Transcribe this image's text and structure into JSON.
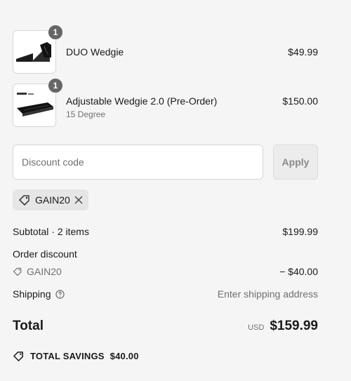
{
  "items": [
    {
      "name": "DUO Wedgie",
      "variant": "",
      "price": "$49.99",
      "quantity": "1",
      "image_icon": "duo-wedgie-thumbnail"
    },
    {
      "name": "Adjustable Wedgie 2.0 (Pre-Order)",
      "variant": "15 Degree",
      "price": "$150.00",
      "quantity": "1",
      "image_icon": "adjustable-wedgie-thumbnail"
    }
  ],
  "discount": {
    "placeholder": "Discount code",
    "apply_label": "Apply",
    "applied_code": "GAIN20"
  },
  "summary": {
    "subtotal_label": "Subtotal · 2 items",
    "subtotal_value": "$199.99",
    "order_discount_label": "Order discount",
    "order_discount_code": "GAIN20",
    "order_discount_value": "− $40.00",
    "shipping_label": "Shipping",
    "shipping_value": "Enter shipping address",
    "total_label": "Total",
    "currency": "USD",
    "total_value": "$159.99",
    "savings_label": "TOTAL SAVINGS",
    "savings_value": "$40.00"
  },
  "colors": {
    "background": "#f5f5f5",
    "badge": "#666666",
    "muted_text": "#707070"
  }
}
